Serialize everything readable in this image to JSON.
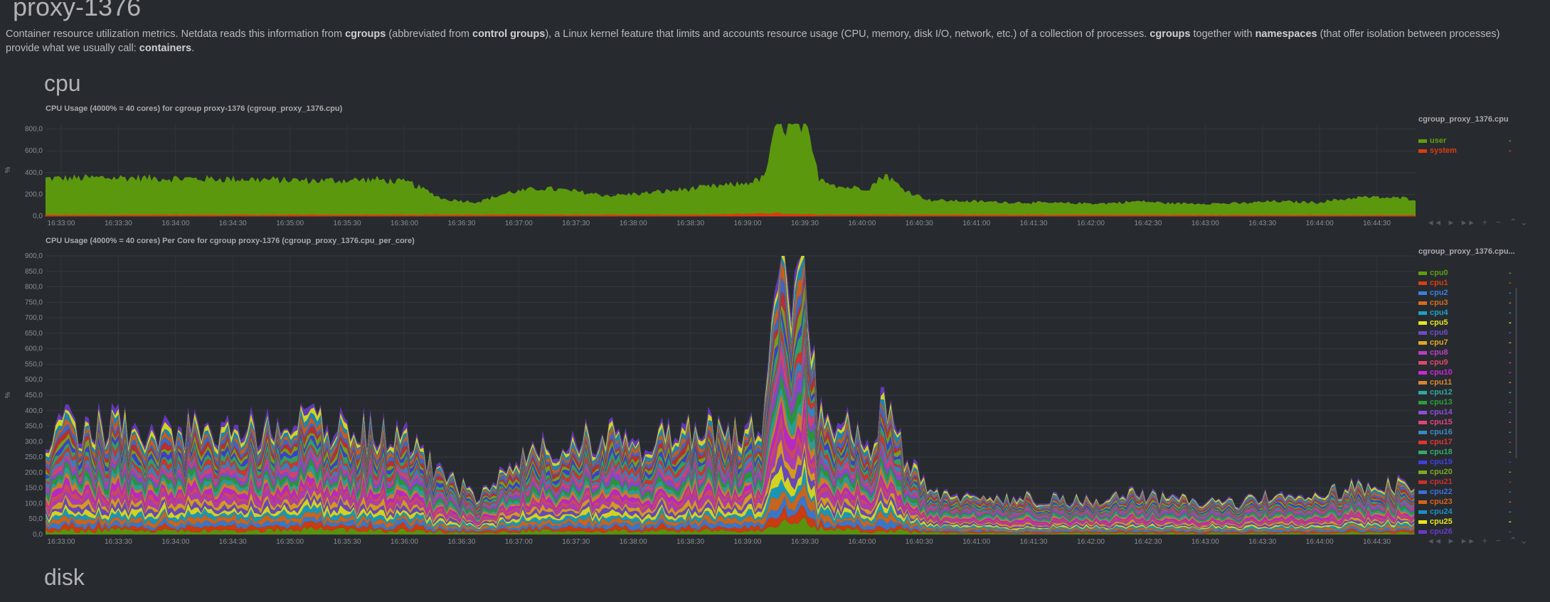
{
  "page": {
    "title": "proxy-1376",
    "intro_parts": [
      {
        "text": "Container resource utilization metrics. Netdata reads this information from ",
        "bold": false
      },
      {
        "text": "cgroups",
        "bold": true
      },
      {
        "text": " (abbreviated from ",
        "bold": false
      },
      {
        "text": "control groups",
        "bold": true
      },
      {
        "text": "), a Linux kernel feature that limits and accounts resource usage (CPU, memory, disk I/O, network, etc.) of a collection of processes. ",
        "bold": false
      },
      {
        "text": "cgroups",
        "bold": true
      },
      {
        "text": " together with ",
        "bold": false
      },
      {
        "text": "namespaces",
        "bold": true
      },
      {
        "text": " (that offer isolation between processes) provide what we usually call: ",
        "bold": false
      },
      {
        "text": "containers",
        "bold": true
      },
      {
        "text": ".",
        "bold": false
      }
    ],
    "sections": {
      "cpu": "cpu",
      "disk": "disk"
    },
    "tools": "◂◂ ▸ ▸▸ + − ⌃⌄"
  },
  "chart_data": [
    {
      "type": "area",
      "title": "CPU Usage (4000% = 40 cores) for cgroup proxy-1376 (cgroup_proxy_1376.cpu)",
      "ylabel": "%",
      "ylim": [
        0,
        850
      ],
      "yticks": [
        "0,0",
        "200,0",
        "400,0",
        "600,0",
        "800,0"
      ],
      "ytick_values": [
        0,
        200,
        400,
        600,
        800
      ],
      "xticks": [
        "16:33:00",
        "16:33:30",
        "16:34:00",
        "16:34:30",
        "16:35:00",
        "16:35:30",
        "16:36:00",
        "16:36:30",
        "16:37:00",
        "16:37:30",
        "16:38:00",
        "16:38:30",
        "16:39:00",
        "16:39:30",
        "16:40:00",
        "16:40:30",
        "16:41:00",
        "16:41:30",
        "16:42:00",
        "16:42:30",
        "16:43:00",
        "16:43:30",
        "16:44:00",
        "16:44:30"
      ],
      "legend_title": "cgroup_proxy_1376.cpu",
      "legend_value": "-",
      "series": [
        {
          "name": "user",
          "color": "#5f9e0d",
          "approx_trend": [
            [
              0,
              340
            ],
            [
              60,
              350
            ],
            [
              120,
              340
            ],
            [
              180,
              335
            ],
            [
              240,
              320
            ],
            [
              300,
              330
            ],
            [
              330,
              300
            ],
            [
              360,
              150
            ],
            [
              390,
              120
            ],
            [
              420,
              210
            ],
            [
              450,
              250
            ],
            [
              480,
              220
            ],
            [
              510,
              180
            ],
            [
              540,
              200
            ],
            [
              570,
              230
            ],
            [
              600,
              260
            ],
            [
              630,
              280
            ],
            [
              650,
              330
            ],
            [
              662,
              820
            ],
            [
              672,
              800
            ],
            [
              688,
              820
            ],
            [
              700,
              350
            ],
            [
              720,
              260
            ],
            [
              745,
              250
            ],
            [
              760,
              380
            ],
            [
              775,
              250
            ],
            [
              790,
              180
            ],
            [
              800,
              140
            ],
            [
              830,
              130
            ],
            [
              870,
              120
            ],
            [
              930,
              110
            ],
            [
              960,
              110
            ],
            [
              990,
              130
            ],
            [
              1020,
              110
            ],
            [
              1080,
              110
            ],
            [
              1110,
              130
            ],
            [
              1150,
              120
            ],
            [
              1190,
              170
            ],
            [
              1230,
              160
            ],
            [
              1240,
              150
            ]
          ]
        },
        {
          "name": "system",
          "color": "#db3d0d",
          "approx_trend": [
            [
              0,
              8
            ],
            [
              600,
              10
            ],
            [
              660,
              25
            ],
            [
              700,
              10
            ],
            [
              1240,
              6
            ]
          ]
        }
      ]
    },
    {
      "type": "area",
      "title": "CPU Usage (4000% = 40 cores) Per Core for cgroup proxy-1376 (cgroup_proxy_1376.cpu_per_core)",
      "ylabel": "%",
      "ylim": [
        0,
        900
      ],
      "yticks": [
        "0,0",
        "50,0",
        "100,0",
        "150,0",
        "200,0",
        "250,0",
        "300,0",
        "350,0",
        "400,0",
        "450,0",
        "500,0",
        "550,0",
        "600,0",
        "650,0",
        "700,0",
        "750,0",
        "800,0",
        "850,0",
        "900,0"
      ],
      "ytick_values": [
        0,
        50,
        100,
        150,
        200,
        250,
        300,
        350,
        400,
        450,
        500,
        550,
        600,
        650,
        700,
        750,
        800,
        850,
        900
      ],
      "xticks": [
        "16:33:00",
        "16:33:30",
        "16:34:00",
        "16:34:30",
        "16:35:00",
        "16:35:30",
        "16:36:00",
        "16:36:30",
        "16:37:00",
        "16:37:30",
        "16:38:00",
        "16:38:30",
        "16:39:00",
        "16:39:30",
        "16:40:00",
        "16:40:30",
        "16:41:00",
        "16:41:30",
        "16:42:00",
        "16:42:30",
        "16:43:00",
        "16:43:30",
        "16:44:00",
        "16:44:30"
      ],
      "legend_title": "cgroup_proxy_1376.cpu...",
      "legend_value": "-",
      "series": [
        {
          "name": "cpu0",
          "color": "#5f9e0d"
        },
        {
          "name": "cpu1",
          "color": "#db3d0d"
        },
        {
          "name": "cpu2",
          "color": "#3d7ed8"
        },
        {
          "name": "cpu3",
          "color": "#d86b1e"
        },
        {
          "name": "cpu4",
          "color": "#1ba1c4"
        },
        {
          "name": "cpu5",
          "color": "#e7e41f"
        },
        {
          "name": "cpu6",
          "color": "#6f4ac9"
        },
        {
          "name": "cpu7",
          "color": "#e7a51f"
        },
        {
          "name": "cpu8",
          "color": "#b83ec4"
        },
        {
          "name": "cpu9",
          "color": "#db4a6a"
        },
        {
          "name": "cpu10",
          "color": "#c928d8"
        },
        {
          "name": "cpu11",
          "color": "#d8862e"
        },
        {
          "name": "cpu12",
          "color": "#2ea8a0"
        },
        {
          "name": "cpu13",
          "color": "#2e9e3a"
        },
        {
          "name": "cpu14",
          "color": "#8d4ed8"
        },
        {
          "name": "cpu15",
          "color": "#e0457b"
        },
        {
          "name": "cpu16",
          "color": "#3c89c4"
        },
        {
          "name": "cpu17",
          "color": "#e0362e"
        },
        {
          "name": "cpu18",
          "color": "#36a86a"
        },
        {
          "name": "cpu19",
          "color": "#4040e0"
        },
        {
          "name": "cpu20",
          "color": "#7ea81e"
        },
        {
          "name": "cpu21",
          "color": "#c9302e"
        },
        {
          "name": "cpu22",
          "color": "#3d6ed8"
        },
        {
          "name": "cpu23",
          "color": "#d8621e"
        },
        {
          "name": "cpu24",
          "color": "#1b8ec4"
        },
        {
          "name": "cpu25",
          "color": "#e7e41f"
        },
        {
          "name": "cpu26",
          "color": "#6a3ac9"
        }
      ],
      "approx_total_trend": [
        [
          0,
          360
        ],
        [
          60,
          380
        ],
        [
          120,
          360
        ],
        [
          180,
          360
        ],
        [
          240,
          380
        ],
        [
          300,
          360
        ],
        [
          330,
          330
        ],
        [
          360,
          200
        ],
        [
          390,
          140
        ],
        [
          420,
          220
        ],
        [
          450,
          300
        ],
        [
          480,
          330
        ],
        [
          510,
          340
        ],
        [
          540,
          300
        ],
        [
          570,
          350
        ],
        [
          600,
          380
        ],
        [
          630,
          360
        ],
        [
          650,
          380
        ],
        [
          662,
          900
        ],
        [
          672,
          820
        ],
        [
          688,
          880
        ],
        [
          700,
          420
        ],
        [
          720,
          380
        ],
        [
          745,
          300
        ],
        [
          760,
          460
        ],
        [
          775,
          300
        ],
        [
          790,
          200
        ],
        [
          800,
          150
        ],
        [
          830,
          140
        ],
        [
          870,
          130
        ],
        [
          930,
          120
        ],
        [
          960,
          120
        ],
        [
          990,
          140
        ],
        [
          1020,
          120
        ],
        [
          1080,
          110
        ],
        [
          1110,
          140
        ],
        [
          1150,
          130
        ],
        [
          1190,
          170
        ],
        [
          1230,
          180
        ],
        [
          1240,
          160
        ]
      ]
    }
  ]
}
